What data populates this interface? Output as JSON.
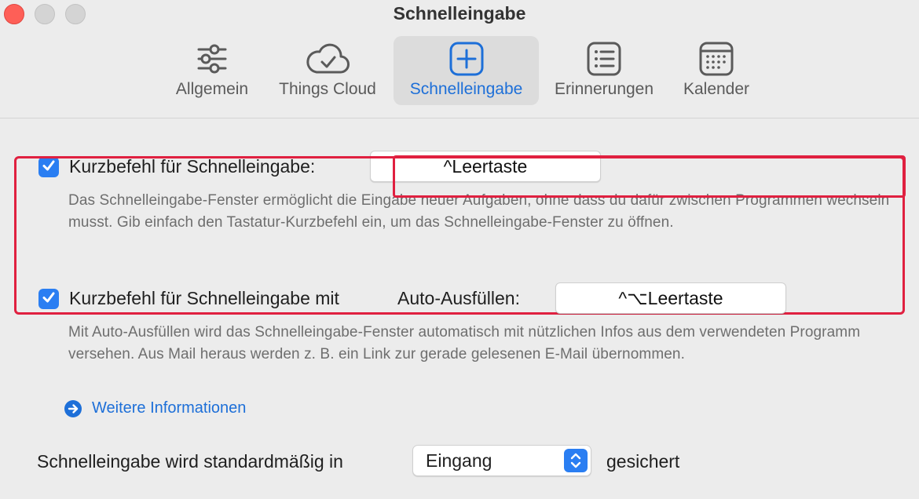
{
  "window": {
    "title": "Schnelleingabe"
  },
  "tabs": [
    {
      "label": "Allgemein",
      "icon": "sliders-icon",
      "active": false
    },
    {
      "label": "Things Cloud",
      "icon": "cloud-check-icon",
      "active": false
    },
    {
      "label": "Schnelleingabe",
      "icon": "plus-square-icon",
      "active": true
    },
    {
      "label": "Erinnerungen",
      "icon": "list-icon",
      "active": false
    },
    {
      "label": "Kalender",
      "icon": "calendar-icon",
      "active": false
    }
  ],
  "quick_entry": {
    "checked": true,
    "label": "Kurzbefehl für Schnelleingabe:",
    "shortcut": "^Leertaste",
    "description": "Das Schnelleingabe-Fenster ermöglicht die Eingabe neuer Aufgaben, ohne dass du dafür zwischen Programmen wechseln musst. Gib einfach den Tastatur-Kurzbefehl ein, um das Schnelleingabe-Fenster zu öffnen."
  },
  "autofill": {
    "checked": true,
    "label_part1": "Kurzbefehl für Schnelleingabe mit",
    "label_part2": "Auto-Ausfüllen:",
    "shortcut": "^⌥Leertaste",
    "description": "Mit Auto-Ausfüllen wird das Schnelleingabe-Fenster automatisch mit nützlichen Infos aus dem verwendeten Programm versehen. Aus Mail heraus werden z. B. ein Link zur gerade gelesenen E-Mail übernommen.",
    "more_info": "Weitere Informationen"
  },
  "save_location": {
    "prefix": "Schnelleingabe wird standardmäßig in",
    "value": "Eingang",
    "suffix": "gesichert"
  },
  "colors": {
    "accent": "#2a7ef2",
    "highlight": "#e02040",
    "link": "#1d6fd8"
  }
}
